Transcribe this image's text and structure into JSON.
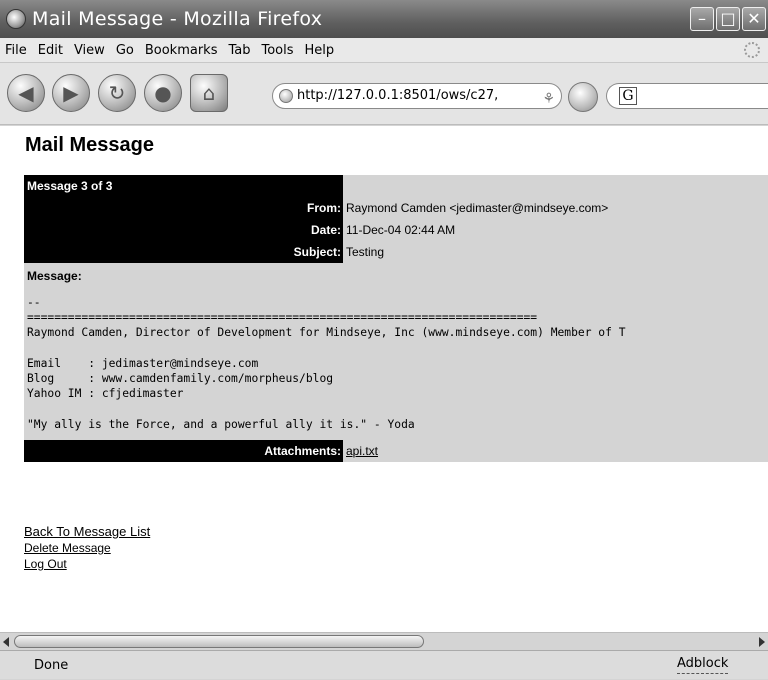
{
  "window": {
    "title": "Mail Message - Mozilla Firefox"
  },
  "menu": [
    "File",
    "Edit",
    "View",
    "Go",
    "Bookmarks",
    "Tab",
    "Tools",
    "Help"
  ],
  "nav": {
    "url": "http://127.0.0.1:8501/ows/c27,",
    "search_placeholder": ""
  },
  "page": {
    "heading": "Mail Message",
    "message_counter": "Message 3 of 3",
    "from_label": "From:",
    "from_value": "Raymond Camden <jedimaster@mindseye.com>",
    "date_label": "Date:",
    "date_value": "11-Dec-04 02:44 AM",
    "subject_label": "Subject:",
    "subject_value": "Testing",
    "message_label": "Message:",
    "body": "--\n===========================================================================\nRaymond Camden, Director of Development for Mindseye, Inc (www.mindseye.com) Member of T\n\nEmail    : jedimaster@mindseye.com\nBlog     : www.camdenfamily.com/morpheus/blog\nYahoo IM : cfjedimaster\n\n\"My ally is the Force, and a powerful ally it is.\" - Yoda",
    "attachments_label": "Attachments:",
    "attachment": "api.txt",
    "links": [
      "Back To Message List",
      "Delete Message",
      "Log Out"
    ]
  },
  "status": {
    "text": "Done",
    "adblock": "Adblock"
  },
  "icons": {
    "back": "back-arrow-icon",
    "forward": "forward-arrow-icon",
    "reload": "reload-icon",
    "stop": "stop-icon",
    "home": "home-icon",
    "go": "go-icon",
    "search_engine": "google-icon"
  }
}
